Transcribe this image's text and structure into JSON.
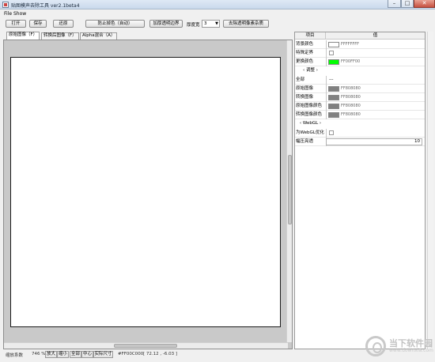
{
  "window": {
    "title": "贴图模声去除工具 ver2.1beta4",
    "minimize_glyph": "–",
    "maximize_glyph": "□",
    "close_glyph": "✕"
  },
  "menu": [
    "File",
    "Show"
  ],
  "toolbar": {
    "open_label": "打开",
    "save_label": "保存",
    "restore_label": "还原",
    "prevent_mix_label": "防止掉色（自动）",
    "thicken_label": "加厚透明边界",
    "thickness_label": "厚度宽",
    "thickness_value": "3",
    "remove_noise_label": "去除透明像素杂质"
  },
  "tabs": [
    "原始图像（F）",
    "转换后图像（F）",
    "Alpha混合（A）"
  ],
  "statusbar": {
    "scale_label": "缩放系数",
    "scale_value": "746 %",
    "zoom_in": "放大",
    "zoom_out": "缩小",
    "all": "全部",
    "center": "中心",
    "actual_size": "实际尺寸",
    "pixel_color": "#FF00C000",
    "coords": "[  72.12 ,   -6.03  ]"
  },
  "property_grid": {
    "col_item": "项目",
    "col_value": "值",
    "rows": {
      "bg_color": {
        "name": "背景颜色",
        "value": "FFFFFFFF",
        "color": "#ffffff"
      },
      "special_location": {
        "name": "特殊定界"
      },
      "replace_color": {
        "name": "更换颜色",
        "value": "FF00FF00",
        "color": "#00ff00"
      },
      "group1": "调整",
      "full": {
        "name": "全部",
        "value": "---"
      },
      "orig_image": {
        "name": "原始图像",
        "value": "FF808080",
        "color": "#808080"
      },
      "conv_image": {
        "name": "转换图像",
        "value": "FF808080",
        "color": "#808080"
      },
      "orig_image_color": {
        "name": "原始图像颜色",
        "value": "FF808080",
        "color": "#808080"
      },
      "conv_image_color": {
        "name": "转换图像颜色",
        "value": "FF808080",
        "color": "#808080"
      },
      "group2": "WebGL",
      "webgl_opt": {
        "name": "为WebGL优化"
      },
      "brightness": {
        "name": "幅压亮透",
        "value": "10"
      }
    }
  },
  "watermark": {
    "brand": "当下软件园",
    "sub": "www.downxia.com"
  }
}
